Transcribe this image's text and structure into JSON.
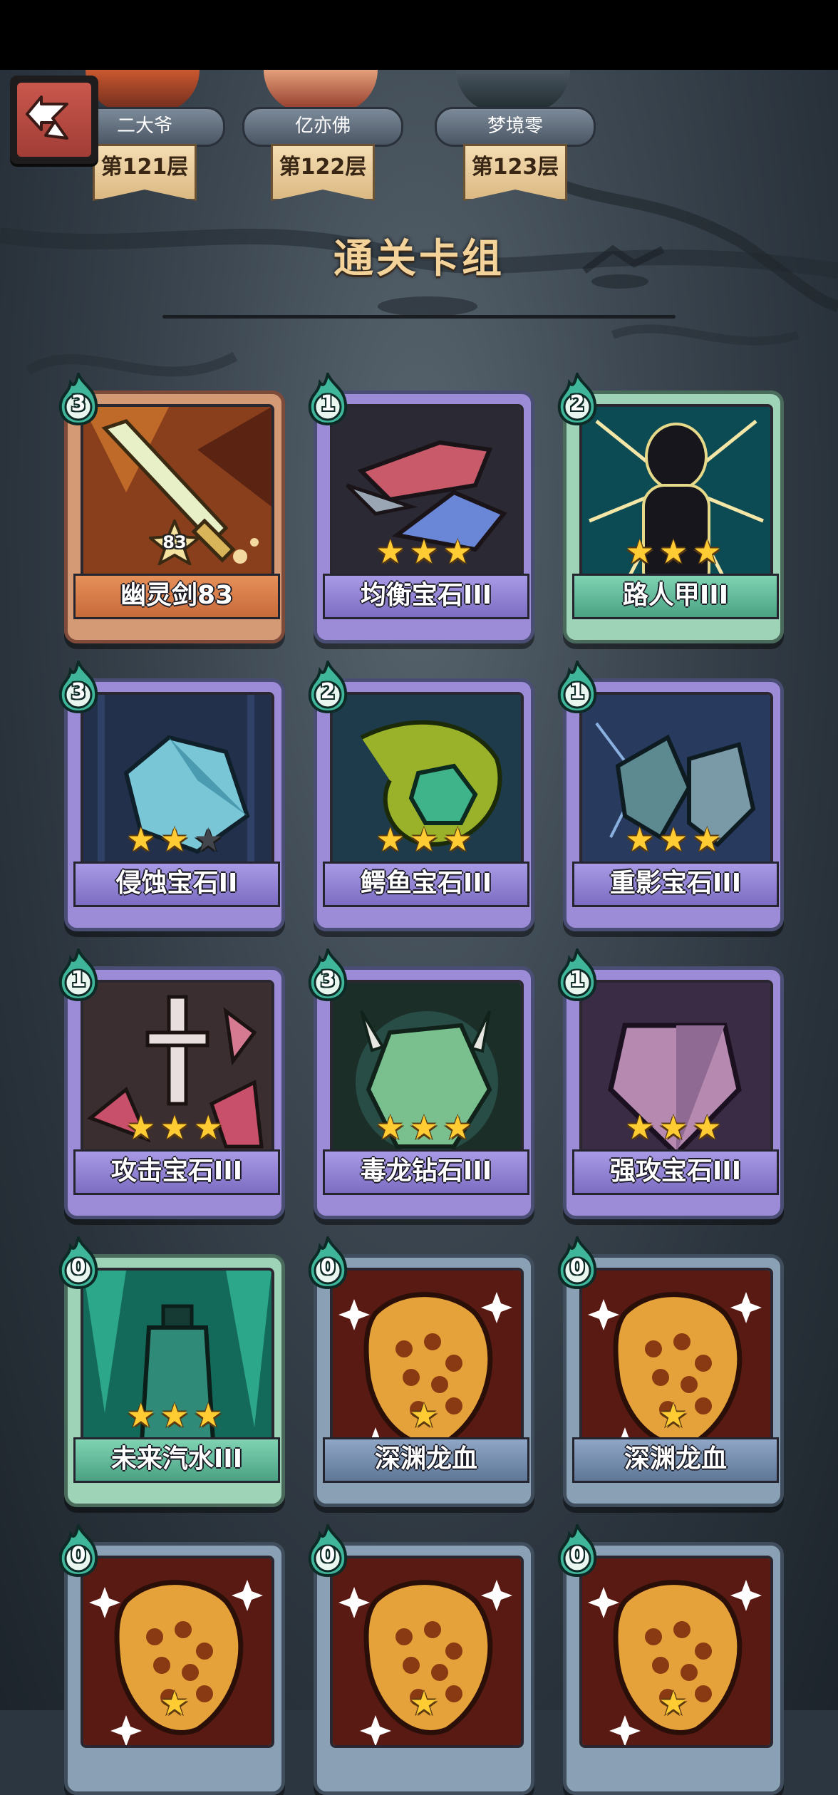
{
  "header": {
    "players": [
      {
        "name": "二大爷",
        "floor": "第121层"
      },
      {
        "name": "亿亦佛",
        "floor": "第122层"
      },
      {
        "name": "梦境零",
        "floor": "第123层"
      }
    ]
  },
  "section_title": "通关卡组",
  "cards": [
    {
      "name": "幽灵剑83",
      "cost": "3",
      "frame": "orange",
      "level": "83",
      "stars": 0,
      "art": "sword"
    },
    {
      "name": "均衡宝石III",
      "cost": "1",
      "frame": "purple",
      "stars": 3,
      "art": "gem-red"
    },
    {
      "name": "路人甲III",
      "cost": "2",
      "frame": "green",
      "stars": 3,
      "art": "figure"
    },
    {
      "name": "侵蚀宝石II",
      "cost": "3",
      "frame": "purple",
      "stars": 2,
      "art": "gem-cyan"
    },
    {
      "name": "鳄鱼宝石III",
      "cost": "2",
      "frame": "purple",
      "stars": 3,
      "art": "croc"
    },
    {
      "name": "重影宝石III",
      "cost": "1",
      "frame": "purple",
      "stars": 3,
      "art": "gem-ghost"
    },
    {
      "name": "攻击宝石III",
      "cost": "1",
      "frame": "purple",
      "stars": 3,
      "art": "gem-attack"
    },
    {
      "name": "毒龙钻石III",
      "cost": "3",
      "frame": "purple",
      "stars": 3,
      "art": "gem-green"
    },
    {
      "name": "强攻宝石III",
      "cost": "1",
      "frame": "purple",
      "stars": 3,
      "art": "gem-pink"
    },
    {
      "name": "未来汽水III",
      "cost": "0",
      "frame": "green",
      "stars": 3,
      "art": "bottle"
    },
    {
      "name": "深渊龙血",
      "cost": "0",
      "frame": "blue",
      "stars": 1,
      "art": "blood"
    },
    {
      "name": "深渊龙血",
      "cost": "0",
      "frame": "blue",
      "stars": 1,
      "art": "blood"
    },
    {
      "name": "",
      "cost": "0",
      "frame": "blue",
      "stars": 1,
      "art": "blood"
    },
    {
      "name": "",
      "cost": "0",
      "frame": "blue",
      "stars": 1,
      "art": "blood"
    },
    {
      "name": "",
      "cost": "0",
      "frame": "blue",
      "stars": 1,
      "art": "blood"
    }
  ],
  "colors": {
    "title": "#f3d39a",
    "star": "#ffcc33",
    "cost_flame": "#3fb59a"
  }
}
